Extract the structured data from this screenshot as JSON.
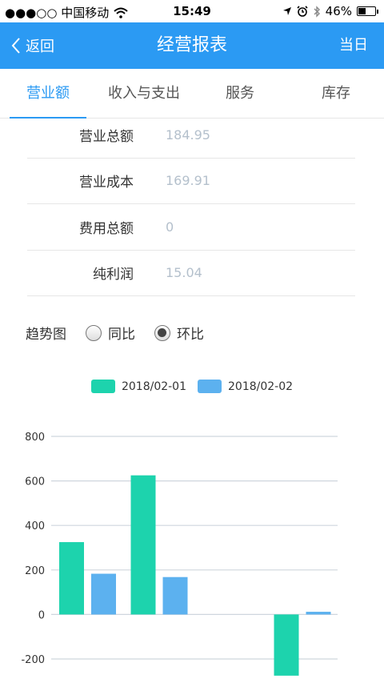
{
  "status_bar": {
    "carrier": "●●●○○ 中国移动",
    "time": "15:49",
    "battery_percent": "46%",
    "battery_level": 0.46
  },
  "nav": {
    "back_label": "返回",
    "title": "经营报表",
    "right_label": "当日"
  },
  "tabs": [
    {
      "label": "营业额",
      "active": true
    },
    {
      "label": "收入与支出",
      "active": false
    },
    {
      "label": "服务",
      "active": false
    },
    {
      "label": "库存",
      "active": false
    }
  ],
  "stats": [
    {
      "label": "营业总额",
      "value": "184.95"
    },
    {
      "label": "营业成本",
      "value": "169.91"
    },
    {
      "label": "费用总额",
      "value": "0"
    },
    {
      "label": "纯利润",
      "value": "15.04"
    }
  ],
  "trend": {
    "label": "趋势图",
    "options": [
      {
        "label": "同比",
        "selected": false
      },
      {
        "label": "环比",
        "selected": true
      }
    ]
  },
  "colors": {
    "accent": "#2b9af3",
    "series_1": "#1dd3ad",
    "series_2": "#5cb1ef"
  },
  "chart_data": {
    "type": "bar",
    "categories": [
      "",
      "",
      "",
      ""
    ],
    "series": [
      {
        "name": "2018/02-01",
        "values": [
          325,
          625,
          0,
          -275
        ]
      },
      {
        "name": "2018/02-02",
        "values": [
          183,
          168,
          0,
          12
        ]
      }
    ],
    "ylim": [
      -200,
      800
    ],
    "y_ticks": [
      800,
      600,
      400,
      200,
      0,
      -200
    ],
    "grid": true,
    "legend_position": "top"
  }
}
